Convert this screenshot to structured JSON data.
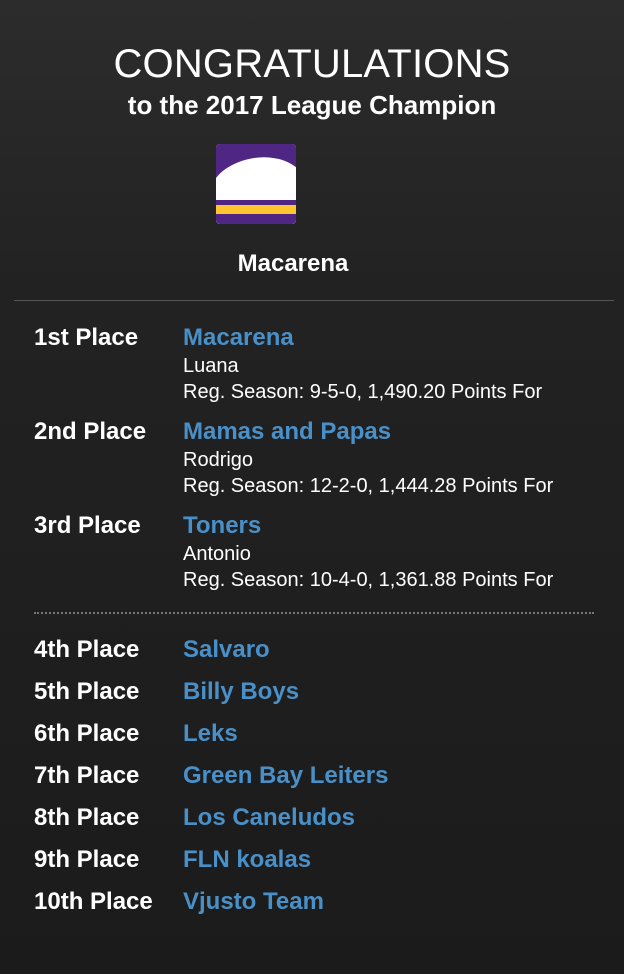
{
  "header": {
    "title": "CONGRATULATIONS",
    "subtitle": "to the 2017 League Champion"
  },
  "champion": {
    "name": "Macarena",
    "logo_colors": {
      "primary": "#4f2683",
      "secondary": "#ffc62f",
      "background": "#ffffff"
    }
  },
  "podium": [
    {
      "place": "1st Place",
      "team": "Macarena",
      "owner": "Luana",
      "record": "Reg. Season: 9-5-0, 1,490.20 Points For"
    },
    {
      "place": "2nd Place",
      "team": "Mamas and Papas",
      "owner": "Rodrigo",
      "record": "Reg. Season: 12-2-0, 1,444.28 Points For"
    },
    {
      "place": "3rd Place",
      "team": "Toners",
      "owner": "Antonio",
      "record": "Reg. Season: 10-4-0, 1,361.88 Points For"
    }
  ],
  "others": [
    {
      "place": "4th Place",
      "team": "Salvaro"
    },
    {
      "place": "5th Place",
      "team": "Billy Boys"
    },
    {
      "place": "6th Place",
      "team": "Leks"
    },
    {
      "place": "7th Place",
      "team": "Green Bay Leiters"
    },
    {
      "place": "8th Place",
      "team": "Los Caneludos"
    },
    {
      "place": "9th Place",
      "team": "FLN koalas"
    },
    {
      "place": "10th Place",
      "team": "Vjusto Team"
    }
  ],
  "colors": {
    "link": "#4a90c8",
    "background": "#1f1f1f",
    "text": "#ffffff"
  }
}
